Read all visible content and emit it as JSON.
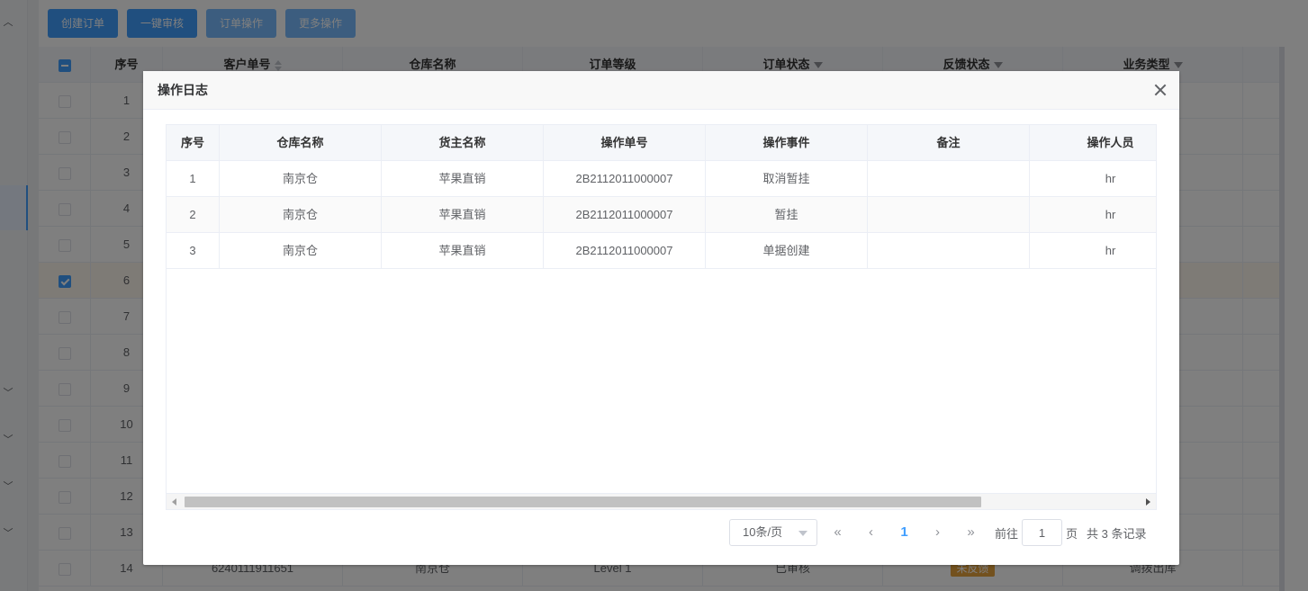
{
  "toolbar": {
    "create_order": "创建订单",
    "one_click_audit": "一键审核",
    "order_ops": "订单操作",
    "more_ops": "更多操作"
  },
  "bg_table": {
    "columns": [
      "序号",
      "客户单号",
      "仓库名称",
      "订单等级",
      "订单状态",
      "反馈状态",
      "业务类型"
    ],
    "rows": [
      {
        "no": "1"
      },
      {
        "no": "2"
      },
      {
        "no": "3"
      },
      {
        "no": "4"
      },
      {
        "no": "5"
      },
      {
        "no": "6"
      },
      {
        "no": "7"
      },
      {
        "no": "8"
      },
      {
        "no": "9"
      },
      {
        "no": "10"
      },
      {
        "no": "11"
      },
      {
        "no": "12"
      },
      {
        "no": "13"
      }
    ],
    "last_row": {
      "no": "14",
      "customer_no": "6240111911651",
      "warehouse": "南京仓",
      "level": "Level 1",
      "status": "已审核",
      "feedback": "未反馈",
      "biz_type": "调拨出库"
    },
    "checked_row_no": "6"
  },
  "dialog": {
    "title": "操作日志",
    "columns": [
      "序号",
      "仓库名称",
      "货主名称",
      "操作单号",
      "操作事件",
      "备注",
      "操作人员"
    ],
    "rows": [
      {
        "no": "1",
        "warehouse": "南京仓",
        "owner": "苹果直销",
        "op_no": "2B2112011000007",
        "event": "取消暂挂",
        "remark": "",
        "operator": "hr"
      },
      {
        "no": "2",
        "warehouse": "南京仓",
        "owner": "苹果直销",
        "op_no": "2B2112011000007",
        "event": "暂挂",
        "remark": "",
        "operator": "hr"
      },
      {
        "no": "3",
        "warehouse": "南京仓",
        "owner": "苹果直销",
        "op_no": "2B2112011000007",
        "event": "单据创建",
        "remark": "",
        "operator": "hr"
      }
    ],
    "pager": {
      "page_size": "10条/页",
      "current_page": "1",
      "goto_label": "前往",
      "goto_value": "1",
      "page_unit": "页",
      "total": "共 3 条记录"
    }
  },
  "colors": {
    "primary": "#409eff",
    "primary_light": "#79bbff",
    "warning": "#e6a23c"
  }
}
